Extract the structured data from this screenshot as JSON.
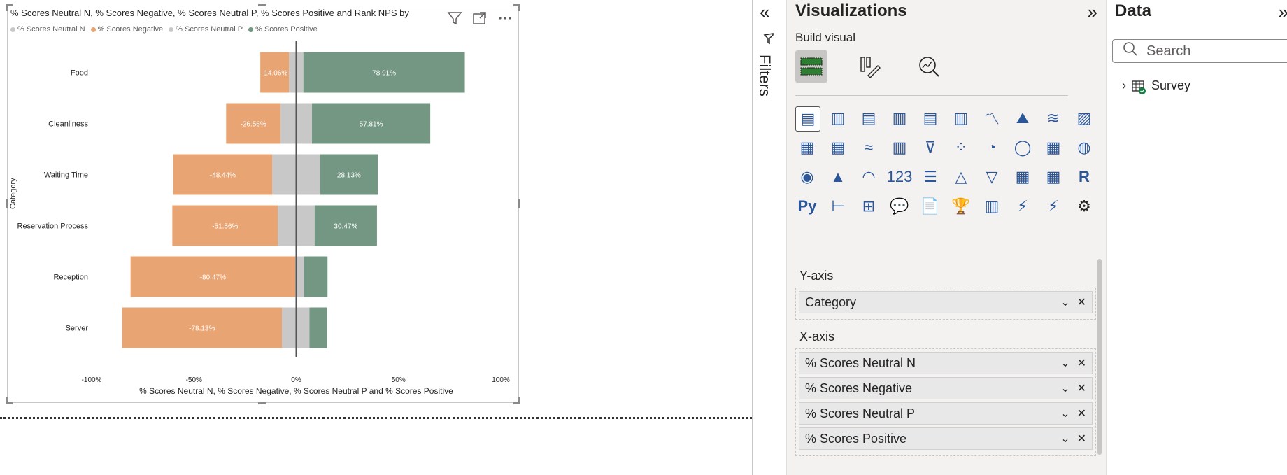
{
  "visual": {
    "title": "% Scores Neutral N, % Scores Negative, % Scores Neutral P, % Scores Positive and Rank NPS by",
    "legend": [
      {
        "label": "% Scores Neutral N",
        "color": "#c8c8c8"
      },
      {
        "label": "% Scores Negative",
        "color": "#e8a472"
      },
      {
        "label": "% Scores Neutral P",
        "color": "#c8c8c8"
      },
      {
        "label": "% Scores Positive",
        "color": "#739782"
      }
    ],
    "icons": [
      "filter-icon",
      "focus-mode-icon",
      "more-options-icon"
    ]
  },
  "chart_data": {
    "type": "bar",
    "orientation": "horizontal",
    "stacked": true,
    "title": "% Scores Neutral N, % Scores Negative, % Scores Neutral P, % Scores Positive and Rank NPS by",
    "xlabel": "% Scores Neutral N, % Scores Negative, % Scores Neutral P and % Scores Positive",
    "ylabel": "Category",
    "xlim": [
      -100,
      100
    ],
    "xticks": [
      "-100%",
      "-50%",
      "0%",
      "50%",
      "100%"
    ],
    "categories": [
      "Food",
      "Cleanliness",
      "Waiting Time",
      "Reservation Process",
      "Reception",
      "Server"
    ],
    "series": [
      {
        "name": "% Scores Neutral N",
        "color": "#c8c8c8",
        "values": [
          -3.5,
          -7.7,
          -11.7,
          -9.0,
          -0.5,
          -7.0
        ]
      },
      {
        "name": "% Scores Negative",
        "color": "#e8a472",
        "values": [
          -14.06,
          -26.56,
          -48.44,
          -51.56,
          -80.47,
          -78.13
        ]
      },
      {
        "name": "% Scores Neutral P",
        "color": "#c8c8c8",
        "values": [
          3.5,
          7.7,
          11.7,
          9.0,
          3.8,
          6.5
        ]
      },
      {
        "name": "% Scores Positive",
        "color": "#739782",
        "values": [
          78.91,
          57.81,
          28.13,
          30.47,
          11.5,
          8.5
        ]
      }
    ],
    "data_labels": {
      "negative": [
        "-14.06%",
        "-26.56%",
        "-48.44%",
        "-51.56%",
        "-80.47%",
        "-78.13%"
      ],
      "positive": [
        "78.91%",
        "57.81%",
        "28.13%",
        "30.47%",
        "",
        ""
      ]
    },
    "grid": false,
    "legend_position": "top-left"
  },
  "filters": {
    "label": "Filters",
    "collapse_icon": "double-chevron-left-icon",
    "filter_icon": "filter-icon"
  },
  "visualizations": {
    "title": "Visualizations",
    "build_label": "Build visual",
    "icons": [
      "stacked-bar-chart-icon",
      "stacked-column-chart-icon",
      "clustered-bar-chart-icon",
      "clustered-column-chart-icon",
      "100-stacked-bar-chart-icon",
      "100-stacked-column-chart-icon",
      "line-chart-icon",
      "area-chart-icon",
      "stacked-area-chart-icon",
      "100-stacked-area-chart-icon",
      "line-and-stacked-column-chart-icon",
      "line-and-clustered-column-chart-icon",
      "ribbon-chart-icon",
      "waterfall-chart-icon",
      "funnel-icon",
      "scatter-chart-icon",
      "pie-chart-icon",
      "donut-chart-icon",
      "treemap-icon",
      "map-icon",
      "filled-map-icon",
      "azure-map-icon",
      "gauge-icon",
      "card-icon",
      "multi-row-card-icon",
      "kpi-icon",
      "slicer-icon",
      "table-icon",
      "matrix-icon",
      "r-visual-icon",
      "python-visual-icon",
      "key-influencers-icon",
      "decomposition-tree-icon",
      "qa-icon",
      "narrative-icon",
      "trophy-icon",
      "paginated-report-icon",
      "power-apps-icon",
      "power-automate-icon",
      "more-visuals-icon"
    ],
    "glyphs": [
      "▤",
      "▥",
      "▤",
      "▥",
      "▤",
      "▥",
      "〽",
      "⛰",
      "≋",
      "▨",
      "▦",
      "▦",
      "≈",
      "▥",
      "⊽",
      "⁘",
      "◔",
      "◯",
      "▦",
      "◍",
      "◉",
      "▲",
      "◠",
      "123",
      "☰",
      "△",
      "▽",
      "▦",
      "▦",
      "R",
      "Py",
      "⊢",
      "⊞",
      "💬",
      "📄",
      "🏆",
      "▥",
      "⚡",
      "⚡",
      "⚙",
      "◇",
      "≫",
      "···"
    ],
    "wells": [
      {
        "label": "Y-axis",
        "fields": [
          "Category"
        ]
      },
      {
        "label": "X-axis",
        "fields": [
          "% Scores Neutral N",
          "% Scores Negative",
          "% Scores Neutral P",
          "% Scores Positive"
        ]
      }
    ]
  },
  "data": {
    "title": "Data",
    "search_placeholder": "Search",
    "tables": [
      "Survey"
    ]
  }
}
